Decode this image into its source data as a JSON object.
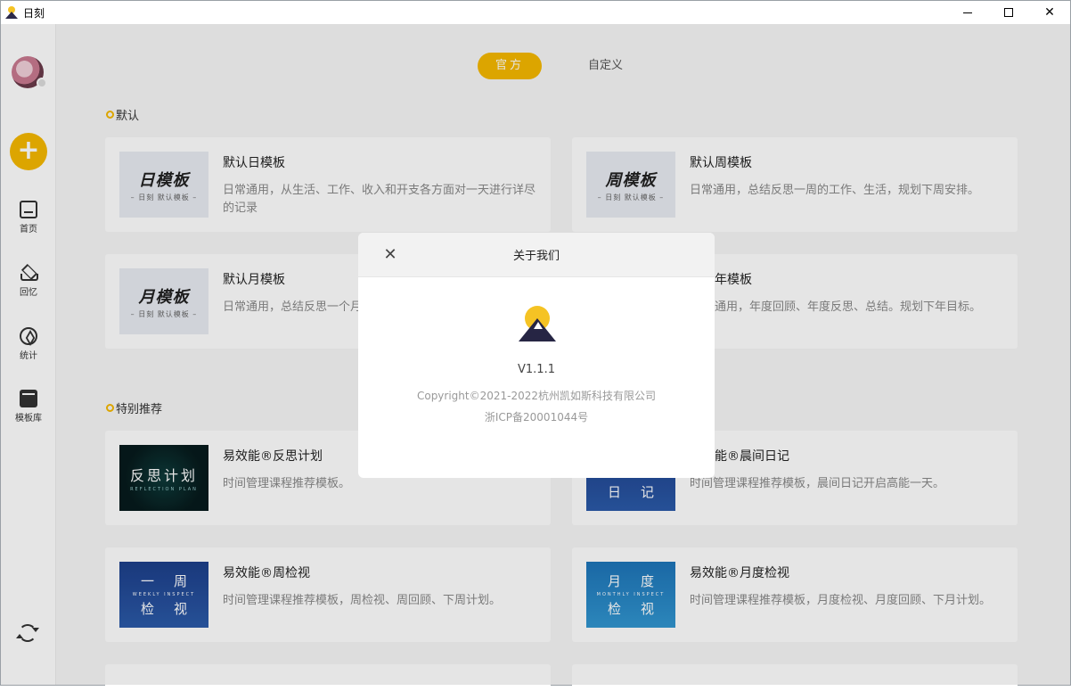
{
  "window": {
    "title": "日刻"
  },
  "sidebar": {
    "items": [
      {
        "label": "首页"
      },
      {
        "label": "回忆"
      },
      {
        "label": "统计"
      },
      {
        "label": "模板库"
      }
    ]
  },
  "tabs": [
    {
      "label": "官方"
    },
    {
      "label": "自定义"
    }
  ],
  "sections": {
    "default": {
      "title": "默认",
      "cards": [
        {
          "title": "默认日模板",
          "desc": "日常通用，从生活、工作、收入和开支各方面对一天进行详尽的记录",
          "thumb_big": "日模板",
          "thumb_small": "– 日刻 默认模板 –"
        },
        {
          "title": "默认周模板",
          "desc": "日常通用，总结反思一周的工作、生活，规划下周安排。",
          "thumb_big": "周模板",
          "thumb_small": "– 日刻 默认模板 –"
        },
        {
          "title": "默认月模板",
          "desc": "日常通用，总结反思一个月",
          "thumb_big": "月模板",
          "thumb_small": "– 日刻 默认模板 –"
        },
        {
          "title": "年模板",
          "desc": "通用，年度回顾、年度反思、总结。规划下年目标。"
        }
      ]
    },
    "recommend": {
      "title": "特别推荐",
      "cards": [
        {
          "title": "易效能®反思计划",
          "desc": "时间管理课程推荐模板。",
          "thumb_big": "反思计划",
          "thumb_small": "REFLECTION PLAN"
        },
        {
          "title": "能®晨间日记",
          "desc": "时间管理课程推荐模板，晨间日记开启高能一天。",
          "thumb_big": "日记"
        },
        {
          "title": "易效能®周检视",
          "desc": "时间管理课程推荐模板，周检视、周回顾、下周计划。",
          "thumb_big_1": "一周",
          "thumb_small": "WEEKLY INSPECT",
          "thumb_big_2": "检视"
        },
        {
          "title": "易效能®月度检视",
          "desc": "时间管理课程推荐模板，月度检视、月度回顾、下月计划。",
          "thumb_big_1": "月度",
          "thumb_small": "MONTHLY INSPECT",
          "thumb_big_2": "检视"
        }
      ]
    }
  },
  "modal": {
    "title": "关于我们",
    "version": "V1.1.1",
    "copyright": "Copyright©2021-2022杭州凯如斯科技有限公司",
    "icp": "浙ICP备20001044号"
  },
  "colors": {
    "accent": "#f5b800"
  }
}
